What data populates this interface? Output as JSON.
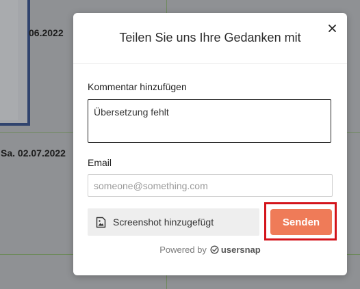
{
  "background": {
    "dates": [
      "06.2022",
      "Sa. 02.07.2022"
    ]
  },
  "modal": {
    "title": "Teilen Sie uns Ihre Gedanken mit",
    "close_icon": "close-icon",
    "comment_label": "Kommentar hinzufügen",
    "comment_value": "Übersetzung fehlt",
    "email_label": "Email",
    "email_value": "",
    "email_placeholder": "someone@something.com",
    "screenshot_label": "Screenshot hinzugefügt",
    "screenshot_icon": "image-icon",
    "send_label": "Senden",
    "powered_by": "Powered by",
    "brand_name": "usersnap",
    "accent_color": "#ef7b58",
    "highlight_color": "#d3141b"
  }
}
